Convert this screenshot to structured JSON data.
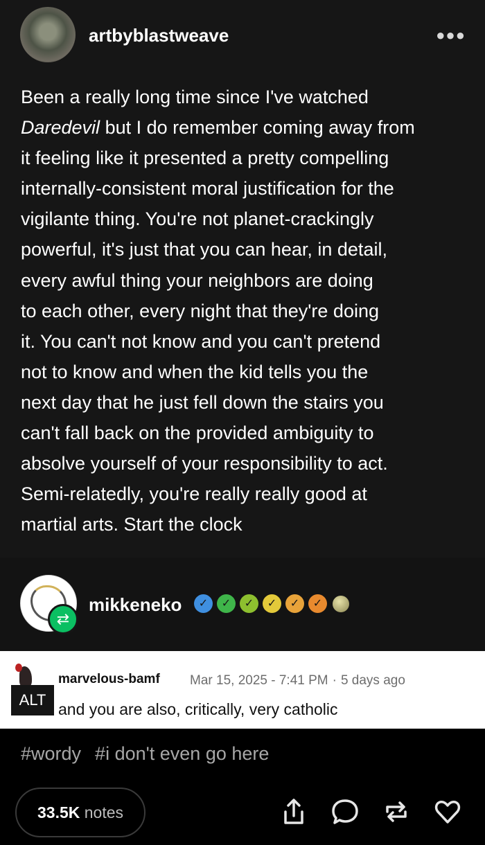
{
  "post": {
    "author": "artbyblastweave",
    "more_icon": "more-horizontal-icon",
    "body_lines": [
      {
        "pre": "Been a really long time since I've watched",
        "em": "",
        "post": ""
      },
      {
        "pre": "",
        "em": "Daredevil",
        "post": " but I do remember coming away from"
      },
      {
        "pre": "it feeling like it presented a pretty compelling",
        "em": "",
        "post": ""
      },
      {
        "pre": "internally-consistent moral justification for the",
        "em": "",
        "post": ""
      },
      {
        "pre": "vigilante thing. You're not planet-crackingly",
        "em": "",
        "post": ""
      },
      {
        "pre": "powerful, it's just that you can hear, in detail,",
        "em": "",
        "post": ""
      },
      {
        "pre": "every awful thing your neighbors are doing",
        "em": "",
        "post": ""
      },
      {
        "pre": "to each other, every night that they're doing",
        "em": "",
        "post": ""
      },
      {
        "pre": "it. You can't not know and you can't pretend",
        "em": "",
        "post": ""
      },
      {
        "pre": "not to know and when the kid tells you the",
        "em": "",
        "post": ""
      },
      {
        "pre": "next day that he just fell down the stairs you",
        "em": "",
        "post": ""
      },
      {
        "pre": "can't fall back on the provided ambiguity to",
        "em": "",
        "post": ""
      },
      {
        "pre": "absolve yourself of your responsibility to act.",
        "em": "",
        "post": ""
      },
      {
        "pre": "Semi-relatedly, you're really really good at",
        "em": "",
        "post": ""
      },
      {
        "pre": "martial arts. Start the clock",
        "em": "",
        "post": ""
      }
    ]
  },
  "reblog": {
    "author": "mikkeneko",
    "reblog_icon": "reblog-icon",
    "badges": [
      {
        "icon": "verified-check-icon",
        "color": "#3f8fe0"
      },
      {
        "icon": "verified-check-icon",
        "color": "#3fb54a"
      },
      {
        "icon": "verified-check-icon",
        "color": "#8dbf2f"
      },
      {
        "icon": "verified-check-icon",
        "color": "#e3c93a"
      },
      {
        "icon": "verified-check-icon",
        "color": "#e8a33a"
      },
      {
        "icon": "verified-check-icon",
        "color": "#e88a2e"
      }
    ],
    "moon_icon": "moon-icon"
  },
  "quoted": {
    "alt_label": "ALT",
    "user": "marvelous-bamf",
    "timestamp": "Mar 15, 2025 - 7:41 PM",
    "separator": "·",
    "relative": "5 days ago",
    "text": "and you are also, critically, very catholic"
  },
  "tags": [
    "#wordy",
    "#i don't even go here"
  ],
  "footer": {
    "notes_count": "33.5K",
    "notes_label": "notes",
    "actions": [
      "share-icon",
      "reply-icon",
      "reblog-icon",
      "like-icon"
    ]
  }
}
